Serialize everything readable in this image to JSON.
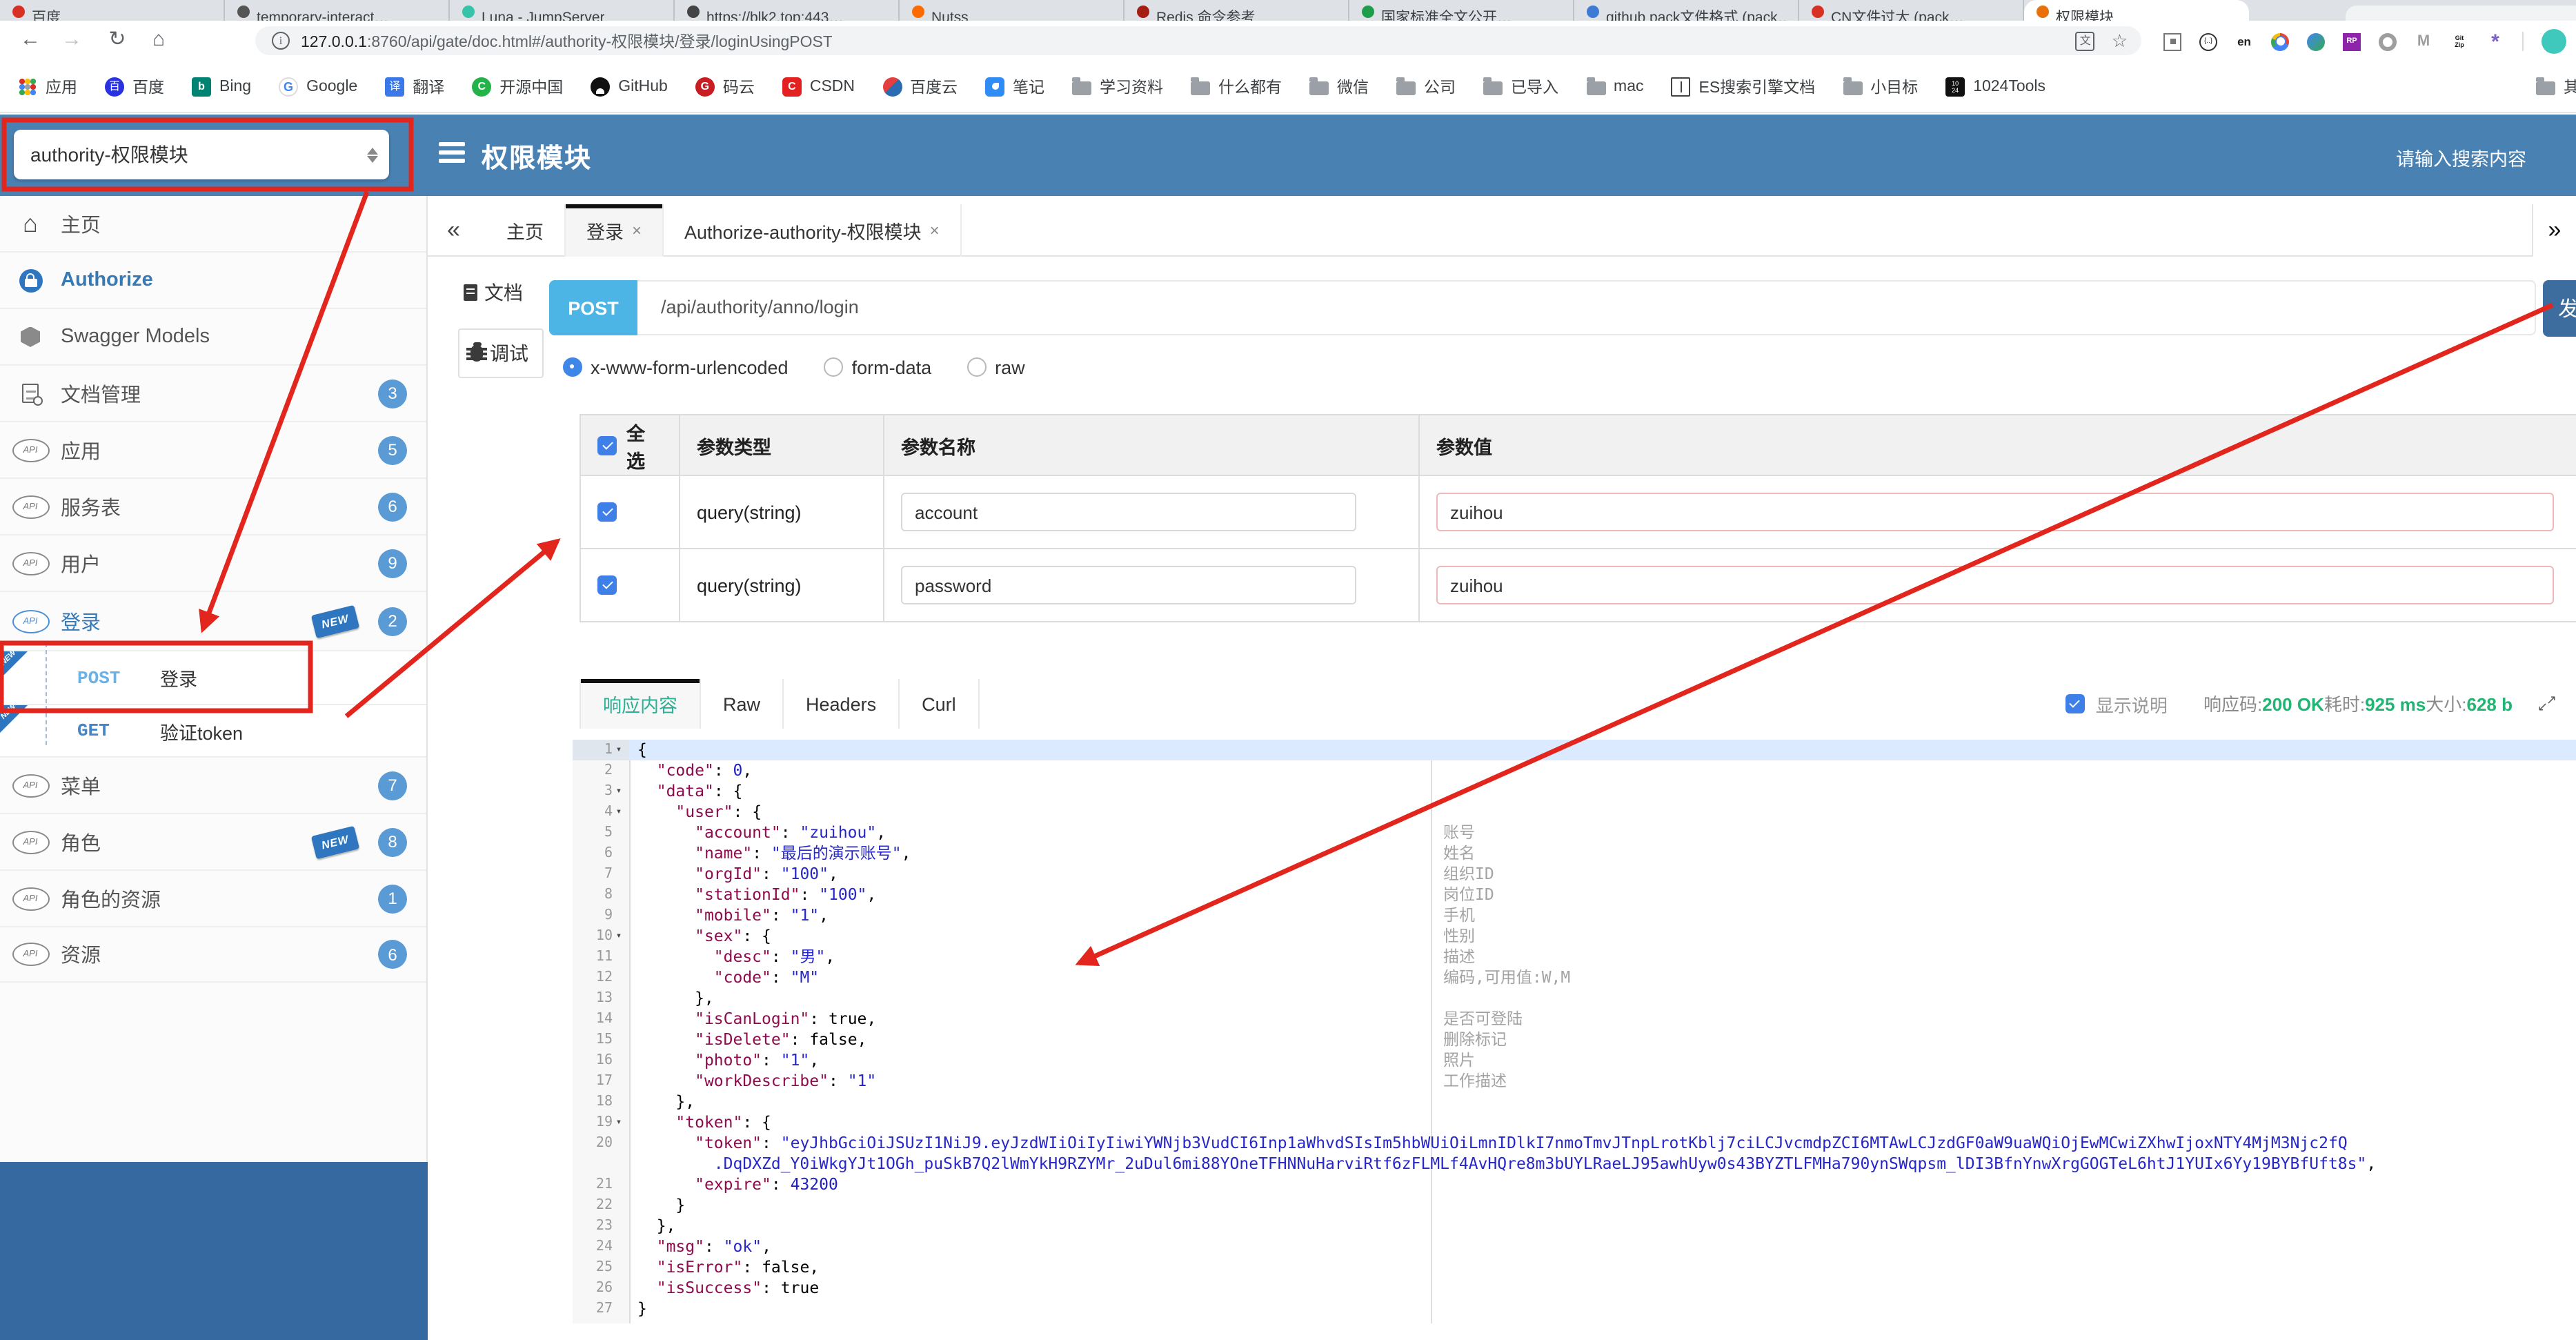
{
  "annotation_color": "#e2261d",
  "browser": {
    "tabs": [
      {
        "title": "百度",
        "color": "#d93025"
      },
      {
        "title": "temporary-interact…",
        "color": "#555555"
      },
      {
        "title": "Luna - JumpServer",
        "color": "#35c3a9"
      },
      {
        "title": "https://blk2.top:443…",
        "color": "#444444"
      },
      {
        "title": "Nutss",
        "color": "#ff6a00"
      },
      {
        "title": "Redis 命令参考",
        "color": "#a41e11"
      },
      {
        "title": "国家标准全文公开…",
        "color": "#1e9e4a"
      },
      {
        "title": "github pack文件格式 (pack…",
        "color": "#3b7bd4"
      },
      {
        "title": "CN文件过大 (pack…",
        "color": "#d93025"
      },
      {
        "title": "权限模块",
        "color": "#e8710a",
        "active": true
      }
    ],
    "toolbar": {
      "url_host": "127.0.0.1",
      "url_rest": ":8760/api/gate/doc.html#/authority-权限模块/登录/loginUsingPOST"
    },
    "extensions": [
      {
        "k": "qr"
      },
      {
        "k": "brace",
        "t": "{..}"
      },
      {
        "k": "en",
        "t": "en"
      },
      {
        "k": "chrome"
      },
      {
        "k": "globe"
      },
      {
        "k": "rp",
        "t": "RP"
      },
      {
        "k": "ring"
      },
      {
        "k": "m",
        "t": "M"
      },
      {
        "k": "gitzip",
        "t": "Git\nZip"
      },
      {
        "k": "aster",
        "t": "*"
      }
    ],
    "bookmarks": [
      {
        "label": "应用",
        "icon": "apps"
      },
      {
        "label": "百度",
        "icon": "baidu",
        "glyph": "百"
      },
      {
        "label": "Bing",
        "icon": "bing",
        "glyph": "b"
      },
      {
        "label": "Google",
        "icon": "google",
        "glyph": "G"
      },
      {
        "label": "翻译",
        "icon": "trans",
        "glyph": "译"
      },
      {
        "label": "开源中国",
        "icon": "osc",
        "glyph": "C"
      },
      {
        "label": "GitHub",
        "icon": "github"
      },
      {
        "label": "码云",
        "icon": "gitee",
        "glyph": "G"
      },
      {
        "label": "CSDN",
        "icon": "csdn",
        "glyph": "C"
      },
      {
        "label": "百度云",
        "icon": "bdyun"
      },
      {
        "label": "笔记",
        "icon": "note"
      },
      {
        "label": "学习资料",
        "icon": "folder"
      },
      {
        "label": "什么都有",
        "icon": "folder"
      },
      {
        "label": "微信",
        "icon": "folder"
      },
      {
        "label": "公司",
        "icon": "folder"
      },
      {
        "label": "已导入",
        "icon": "folder"
      },
      {
        "label": "mac",
        "icon": "folder"
      },
      {
        "label": "ES搜索引擎文档",
        "icon": "book"
      },
      {
        "label": "小目标",
        "icon": "folder"
      },
      {
        "label": "1024Tools",
        "icon": "tools",
        "glyph": "10\n24"
      }
    ],
    "bookmarks_overflow": "其他书签"
  },
  "header": {
    "module_select": "authority-权限模块",
    "title": "权限模块",
    "search_placeholder": "请输入搜索内容"
  },
  "sidebar": {
    "items": [
      {
        "icon": "home",
        "label": "主页"
      },
      {
        "icon": "lock",
        "label": "Authorize",
        "style": "auth"
      },
      {
        "icon": "swagger",
        "label": "Swagger Models"
      },
      {
        "icon": "docs",
        "label": "文档管理",
        "badge": "3"
      },
      {
        "icon": "api",
        "label": "应用",
        "badge": "5"
      },
      {
        "icon": "api",
        "label": "服务表",
        "badge": "6"
      },
      {
        "icon": "api",
        "label": "用户",
        "badge": "9"
      },
      {
        "icon": "api",
        "label": "登录",
        "badge": "2",
        "new": true,
        "active": true
      },
      {
        "sub": true,
        "method": "POST",
        "label": "登录",
        "corner": true
      },
      {
        "sub": true,
        "method": "GET",
        "label": "验证token",
        "corner": true
      },
      {
        "icon": "api",
        "label": "菜单",
        "badge": "7"
      },
      {
        "icon": "api",
        "label": "角色",
        "badge": "8",
        "new": true
      },
      {
        "icon": "api",
        "label": "角色的资源",
        "badge": "1"
      },
      {
        "icon": "api",
        "label": "资源",
        "badge": "6"
      }
    ]
  },
  "doc_tabs": {
    "collapse_icon": "«",
    "expand_icon": "»",
    "tabs": [
      {
        "label": "主页"
      },
      {
        "label": "登录",
        "closable": true,
        "active": true
      },
      {
        "label": "Authorize-authority-权限模块",
        "closable": true
      }
    ]
  },
  "tool_tabs": [
    {
      "label": "文档",
      "icon": "doc"
    },
    {
      "label": "调试",
      "icon": "bug",
      "active": true
    }
  ],
  "request": {
    "method": "POST",
    "url": "/api/authority/anno/login",
    "send_label": "发",
    "content_types": [
      {
        "label": "x-www-form-urlencoded",
        "selected": true
      },
      {
        "label": "form-data"
      },
      {
        "label": "raw"
      }
    ]
  },
  "params": {
    "headers": [
      "全选",
      "参数类型",
      "参数名称",
      "参数值"
    ],
    "rows": [
      {
        "checked": true,
        "type": "query(string)",
        "name": "account",
        "value": "zuihou"
      },
      {
        "checked": true,
        "type": "query(string)",
        "name": "password",
        "value": "zuihou"
      }
    ]
  },
  "response": {
    "tabs": [
      {
        "label": "响应内容",
        "active": true
      },
      {
        "label": "Raw"
      },
      {
        "label": "Headers"
      },
      {
        "label": "Curl"
      }
    ],
    "show_desc_label": "显示说明",
    "meta": [
      {
        "label": "响应码:",
        "value": "200 OK"
      },
      {
        "label": "耗时:",
        "value": "925 ms"
      },
      {
        "label": "大小:",
        "value": "628 b"
      }
    ],
    "status_color": "#21b573"
  },
  "editor": {
    "rows": [
      {
        "n": "1",
        "fold": true,
        "seg": [
          {
            "c": "p",
            "t": "{"
          }
        ]
      },
      {
        "n": "2",
        "seg": [
          {
            "c": "p",
            "t": "  "
          },
          {
            "c": "k",
            "t": "\"code\""
          },
          {
            "c": "p",
            "t": ": "
          },
          {
            "c": "n",
            "t": "0"
          },
          {
            "c": "p",
            "t": ","
          }
        ]
      },
      {
        "n": "3",
        "fold": true,
        "seg": [
          {
            "c": "p",
            "t": "  "
          },
          {
            "c": "k",
            "t": "\"data\""
          },
          {
            "c": "p",
            "t": ": {"
          }
        ]
      },
      {
        "n": "4",
        "fold": true,
        "seg": [
          {
            "c": "p",
            "t": "    "
          },
          {
            "c": "k",
            "t": "\"user\""
          },
          {
            "c": "p",
            "t": ": {"
          }
        ]
      },
      {
        "n": "5",
        "seg": [
          {
            "c": "p",
            "t": "      "
          },
          {
            "c": "k",
            "t": "\"account\""
          },
          {
            "c": "p",
            "t": ": "
          },
          {
            "c": "s",
            "t": "\"zuihou\""
          },
          {
            "c": "p",
            "t": ","
          }
        ]
      },
      {
        "n": "6",
        "seg": [
          {
            "c": "p",
            "t": "      "
          },
          {
            "c": "k",
            "t": "\"name\""
          },
          {
            "c": "p",
            "t": ": "
          },
          {
            "c": "s",
            "t": "\"最后的演示账号\""
          },
          {
            "c": "p",
            "t": ","
          }
        ]
      },
      {
        "n": "7",
        "seg": [
          {
            "c": "p",
            "t": "      "
          },
          {
            "c": "k",
            "t": "\"orgId\""
          },
          {
            "c": "p",
            "t": ": "
          },
          {
            "c": "s",
            "t": "\"100\""
          },
          {
            "c": "p",
            "t": ","
          }
        ]
      },
      {
        "n": "8",
        "seg": [
          {
            "c": "p",
            "t": "      "
          },
          {
            "c": "k",
            "t": "\"stationId\""
          },
          {
            "c": "p",
            "t": ": "
          },
          {
            "c": "s",
            "t": "\"100\""
          },
          {
            "c": "p",
            "t": ","
          }
        ]
      },
      {
        "n": "9",
        "seg": [
          {
            "c": "p",
            "t": "      "
          },
          {
            "c": "k",
            "t": "\"mobile\""
          },
          {
            "c": "p",
            "t": ": "
          },
          {
            "c": "s",
            "t": "\"1\""
          },
          {
            "c": "p",
            "t": ","
          }
        ]
      },
      {
        "n": "10",
        "fold": true,
        "seg": [
          {
            "c": "p",
            "t": "      "
          },
          {
            "c": "k",
            "t": "\"sex\""
          },
          {
            "c": "p",
            "t": ": {"
          }
        ]
      },
      {
        "n": "11",
        "seg": [
          {
            "c": "p",
            "t": "        "
          },
          {
            "c": "k",
            "t": "\"desc\""
          },
          {
            "c": "p",
            "t": ": "
          },
          {
            "c": "s",
            "t": "\"男\""
          },
          {
            "c": "p",
            "t": ","
          }
        ]
      },
      {
        "n": "12",
        "seg": [
          {
            "c": "p",
            "t": "        "
          },
          {
            "c": "k",
            "t": "\"code\""
          },
          {
            "c": "p",
            "t": ": "
          },
          {
            "c": "s",
            "t": "\"M\""
          }
        ]
      },
      {
        "n": "13",
        "seg": [
          {
            "c": "p",
            "t": "      },"
          }
        ]
      },
      {
        "n": "14",
        "seg": [
          {
            "c": "p",
            "t": "      "
          },
          {
            "c": "k",
            "t": "\"isCanLogin\""
          },
          {
            "c": "p",
            "t": ": "
          },
          {
            "c": "b",
            "t": "true"
          },
          {
            "c": "p",
            "t": ","
          }
        ]
      },
      {
        "n": "15",
        "seg": [
          {
            "c": "p",
            "t": "      "
          },
          {
            "c": "k",
            "t": "\"isDelete\""
          },
          {
            "c": "p",
            "t": ": "
          },
          {
            "c": "b",
            "t": "false"
          },
          {
            "c": "p",
            "t": ","
          }
        ]
      },
      {
        "n": "16",
        "seg": [
          {
            "c": "p",
            "t": "      "
          },
          {
            "c": "k",
            "t": "\"photo\""
          },
          {
            "c": "p",
            "t": ": "
          },
          {
            "c": "s",
            "t": "\"1\""
          },
          {
            "c": "p",
            "t": ","
          }
        ]
      },
      {
        "n": "17",
        "seg": [
          {
            "c": "p",
            "t": "      "
          },
          {
            "c": "k",
            "t": "\"workDescribe\""
          },
          {
            "c": "p",
            "t": ": "
          },
          {
            "c": "s",
            "t": "\"1\""
          }
        ]
      },
      {
        "n": "18",
        "seg": [
          {
            "c": "p",
            "t": "    },"
          }
        ]
      },
      {
        "n": "19",
        "fold": true,
        "seg": [
          {
            "c": "p",
            "t": "    "
          },
          {
            "c": "k",
            "t": "\"token\""
          },
          {
            "c": "p",
            "t": ": {"
          }
        ]
      },
      {
        "n": "20",
        "seg": [
          {
            "c": "p",
            "t": "      "
          },
          {
            "c": "k",
            "t": "\"token\""
          },
          {
            "c": "p",
            "t": ": "
          },
          {
            "c": "s",
            "t": "\"eyJhbGciOiJSUzI1NiJ9.eyJzdWIiOiIyIiwiYWNjb3VudCI6Inp1aWhvdSIsIm5hbWUiOiLmnIDlkI7nmoTmvJTnpLrotKblj7ciLCJvcmdpZCI6MTAwLCJzdGF0aW9uaWQiOjEwMCwiZXhwIjoxNTY4MjM3Njc2fQ"
          }
        ]
      },
      {
        "n": "",
        "seg": [
          {
            "c": "s",
            "t": "        .DqDXZd_Y0iWkgYJt1OGh_puSkB7Q2lWmYkH9RZYMr_2uDul6mi88YOneTFHNNuHarviRtf6zFLMLf4AvHQre8m3bUYLRaeLJ95awhUyw0s43BYZTLFMHa790ynSWqpsm_lDI3BfnYnwXrgGOGTeL6htJ1YUIx6Yy19BYBfUft8s\""
          },
          {
            "c": "p",
            "t": ","
          }
        ]
      },
      {
        "n": "21",
        "seg": [
          {
            "c": "p",
            "t": "      "
          },
          {
            "c": "k",
            "t": "\"expire\""
          },
          {
            "c": "p",
            "t": ": "
          },
          {
            "c": "n",
            "t": "43200"
          }
        ]
      },
      {
        "n": "22",
        "seg": [
          {
            "c": "p",
            "t": "    }"
          }
        ]
      },
      {
        "n": "23",
        "seg": [
          {
            "c": "p",
            "t": "  },"
          }
        ]
      },
      {
        "n": "24",
        "seg": [
          {
            "c": "p",
            "t": "  "
          },
          {
            "c": "k",
            "t": "\"msg\""
          },
          {
            "c": "p",
            "t": ": "
          },
          {
            "c": "s",
            "t": "\"ok\""
          },
          {
            "c": "p",
            "t": ","
          }
        ]
      },
      {
        "n": "25",
        "seg": [
          {
            "c": "p",
            "t": "  "
          },
          {
            "c": "k",
            "t": "\"isError\""
          },
          {
            "c": "p",
            "t": ": "
          },
          {
            "c": "b",
            "t": "false"
          },
          {
            "c": "p",
            "t": ","
          }
        ]
      },
      {
        "n": "26",
        "seg": [
          {
            "c": "p",
            "t": "  "
          },
          {
            "c": "k",
            "t": "\"isSuccess\""
          },
          {
            "c": "p",
            "t": ": "
          },
          {
            "c": "b",
            "t": "true"
          }
        ]
      },
      {
        "n": "27",
        "seg": [
          {
            "c": "p",
            "t": "}"
          }
        ]
      }
    ],
    "annotations": [
      {
        "row": 4,
        "text": "账号"
      },
      {
        "row": 5,
        "text": "姓名"
      },
      {
        "row": 6,
        "text": "组织ID"
      },
      {
        "row": 7,
        "text": "岗位ID"
      },
      {
        "row": 8,
        "text": "手机"
      },
      {
        "row": 9,
        "text": "性别"
      },
      {
        "row": 10,
        "text": "描述"
      },
      {
        "row": 11,
        "text": "编码,可用值:W,M"
      },
      {
        "row": 13,
        "text": "是否可登陆"
      },
      {
        "row": 14,
        "text": "删除标记"
      },
      {
        "row": 15,
        "text": "照片"
      },
      {
        "row": 16,
        "text": "工作描述"
      }
    ]
  }
}
